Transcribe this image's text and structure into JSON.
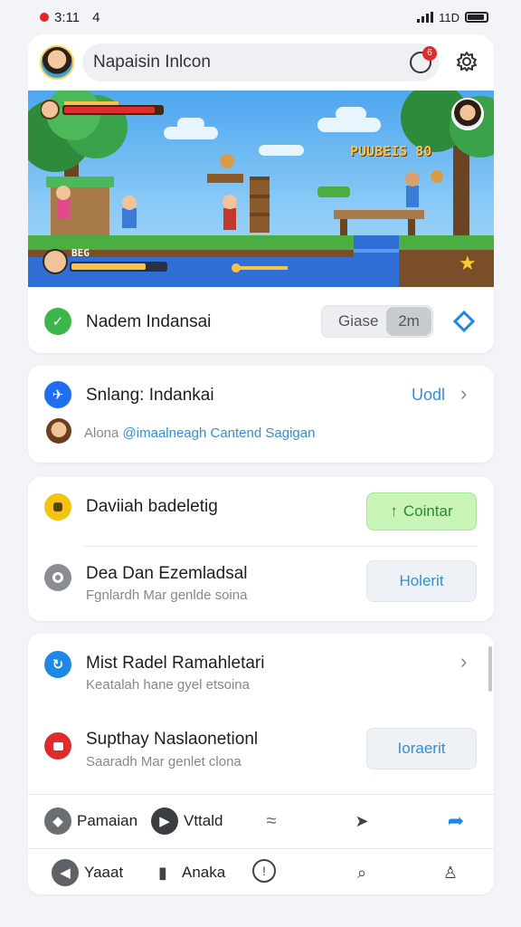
{
  "status": {
    "time": "3:11",
    "extra": "4",
    "network": "11D"
  },
  "header": {
    "search_value": "Napaisin Inlcon",
    "notification_count": "6"
  },
  "banner": {
    "score": "PUUBEIS 80",
    "level": "BEG"
  },
  "card1": {
    "title": "Nadem Indansai",
    "input_label": "Giase",
    "input_value": "2m"
  },
  "card2": {
    "title": "Snlang: Indankai",
    "action": "Uodl",
    "sub_prefix": "Alona",
    "sub_link": "@imaalneagh Cantend Sagigan"
  },
  "card3": {
    "row1_title": "Daviiah badeletig",
    "row1_button": "Cointar",
    "row2_title": "Dea Dan Ezemladsal",
    "row2_sub": "Fgnlardh Mar genlde soina",
    "row2_button": "Holerit"
  },
  "card4": {
    "row1_title": "Mist Radel Ramahletari",
    "row1_sub": "Keatalah hane gyel etsoina",
    "row2_title": "Supthay Naslaonetionl",
    "row2_sub": "Saaradh Mar genlet clona",
    "row2_button": "Ioraerit"
  },
  "tabs_top": [
    {
      "label": "Pamaian"
    },
    {
      "label": "Vttald"
    }
  ],
  "tabs_bottom": [
    {
      "label": "Yaaat"
    },
    {
      "label": "Anaka"
    }
  ],
  "colors": {
    "accent_blue": "#1e88e5",
    "green": "#3cb54a",
    "red": "#e02b2b",
    "yellow": "#f2c40f",
    "pill_green": "#c9f5b8"
  }
}
